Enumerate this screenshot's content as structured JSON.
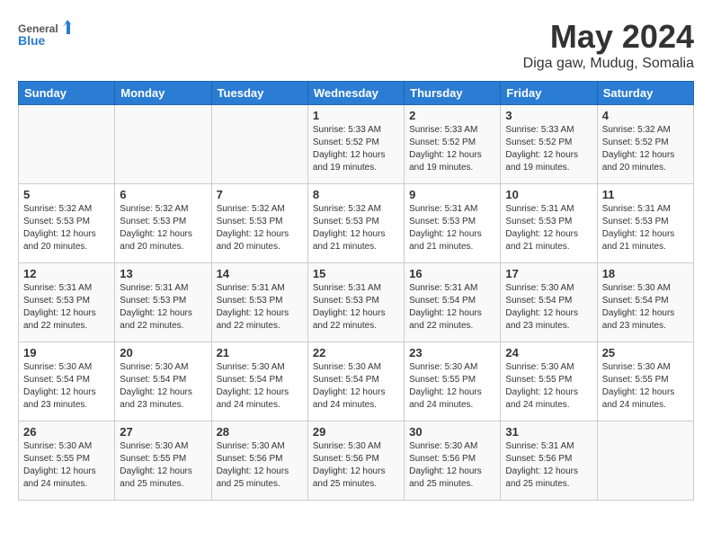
{
  "header": {
    "logo_line1": "General",
    "logo_line2": "Blue",
    "title": "May 2024",
    "subtitle": "Diga gaw, Mudug, Somalia"
  },
  "days_of_week": [
    "Sunday",
    "Monday",
    "Tuesday",
    "Wednesday",
    "Thursday",
    "Friday",
    "Saturday"
  ],
  "weeks": [
    [
      {
        "day": "",
        "info": ""
      },
      {
        "day": "",
        "info": ""
      },
      {
        "day": "",
        "info": ""
      },
      {
        "day": "1",
        "info": "Sunrise: 5:33 AM\nSunset: 5:52 PM\nDaylight: 12 hours\nand 19 minutes."
      },
      {
        "day": "2",
        "info": "Sunrise: 5:33 AM\nSunset: 5:52 PM\nDaylight: 12 hours\nand 19 minutes."
      },
      {
        "day": "3",
        "info": "Sunrise: 5:33 AM\nSunset: 5:52 PM\nDaylight: 12 hours\nand 19 minutes."
      },
      {
        "day": "4",
        "info": "Sunrise: 5:32 AM\nSunset: 5:52 PM\nDaylight: 12 hours\nand 20 minutes."
      }
    ],
    [
      {
        "day": "5",
        "info": "Sunrise: 5:32 AM\nSunset: 5:53 PM\nDaylight: 12 hours\nand 20 minutes."
      },
      {
        "day": "6",
        "info": "Sunrise: 5:32 AM\nSunset: 5:53 PM\nDaylight: 12 hours\nand 20 minutes."
      },
      {
        "day": "7",
        "info": "Sunrise: 5:32 AM\nSunset: 5:53 PM\nDaylight: 12 hours\nand 20 minutes."
      },
      {
        "day": "8",
        "info": "Sunrise: 5:32 AM\nSunset: 5:53 PM\nDaylight: 12 hours\nand 21 minutes."
      },
      {
        "day": "9",
        "info": "Sunrise: 5:31 AM\nSunset: 5:53 PM\nDaylight: 12 hours\nand 21 minutes."
      },
      {
        "day": "10",
        "info": "Sunrise: 5:31 AM\nSunset: 5:53 PM\nDaylight: 12 hours\nand 21 minutes."
      },
      {
        "day": "11",
        "info": "Sunrise: 5:31 AM\nSunset: 5:53 PM\nDaylight: 12 hours\nand 21 minutes."
      }
    ],
    [
      {
        "day": "12",
        "info": "Sunrise: 5:31 AM\nSunset: 5:53 PM\nDaylight: 12 hours\nand 22 minutes."
      },
      {
        "day": "13",
        "info": "Sunrise: 5:31 AM\nSunset: 5:53 PM\nDaylight: 12 hours\nand 22 minutes."
      },
      {
        "day": "14",
        "info": "Sunrise: 5:31 AM\nSunset: 5:53 PM\nDaylight: 12 hours\nand 22 minutes."
      },
      {
        "day": "15",
        "info": "Sunrise: 5:31 AM\nSunset: 5:53 PM\nDaylight: 12 hours\nand 22 minutes."
      },
      {
        "day": "16",
        "info": "Sunrise: 5:31 AM\nSunset: 5:54 PM\nDaylight: 12 hours\nand 22 minutes."
      },
      {
        "day": "17",
        "info": "Sunrise: 5:30 AM\nSunset: 5:54 PM\nDaylight: 12 hours\nand 23 minutes."
      },
      {
        "day": "18",
        "info": "Sunrise: 5:30 AM\nSunset: 5:54 PM\nDaylight: 12 hours\nand 23 minutes."
      }
    ],
    [
      {
        "day": "19",
        "info": "Sunrise: 5:30 AM\nSunset: 5:54 PM\nDaylight: 12 hours\nand 23 minutes."
      },
      {
        "day": "20",
        "info": "Sunrise: 5:30 AM\nSunset: 5:54 PM\nDaylight: 12 hours\nand 23 minutes."
      },
      {
        "day": "21",
        "info": "Sunrise: 5:30 AM\nSunset: 5:54 PM\nDaylight: 12 hours\nand 24 minutes."
      },
      {
        "day": "22",
        "info": "Sunrise: 5:30 AM\nSunset: 5:54 PM\nDaylight: 12 hours\nand 24 minutes."
      },
      {
        "day": "23",
        "info": "Sunrise: 5:30 AM\nSunset: 5:55 PM\nDaylight: 12 hours\nand 24 minutes."
      },
      {
        "day": "24",
        "info": "Sunrise: 5:30 AM\nSunset: 5:55 PM\nDaylight: 12 hours\nand 24 minutes."
      },
      {
        "day": "25",
        "info": "Sunrise: 5:30 AM\nSunset: 5:55 PM\nDaylight: 12 hours\nand 24 minutes."
      }
    ],
    [
      {
        "day": "26",
        "info": "Sunrise: 5:30 AM\nSunset: 5:55 PM\nDaylight: 12 hours\nand 24 minutes."
      },
      {
        "day": "27",
        "info": "Sunrise: 5:30 AM\nSunset: 5:55 PM\nDaylight: 12 hours\nand 25 minutes."
      },
      {
        "day": "28",
        "info": "Sunrise: 5:30 AM\nSunset: 5:56 PM\nDaylight: 12 hours\nand 25 minutes."
      },
      {
        "day": "29",
        "info": "Sunrise: 5:30 AM\nSunset: 5:56 PM\nDaylight: 12 hours\nand 25 minutes."
      },
      {
        "day": "30",
        "info": "Sunrise: 5:30 AM\nSunset: 5:56 PM\nDaylight: 12 hours\nand 25 minutes."
      },
      {
        "day": "31",
        "info": "Sunrise: 5:31 AM\nSunset: 5:56 PM\nDaylight: 12 hours\nand 25 minutes."
      },
      {
        "day": "",
        "info": ""
      }
    ]
  ]
}
